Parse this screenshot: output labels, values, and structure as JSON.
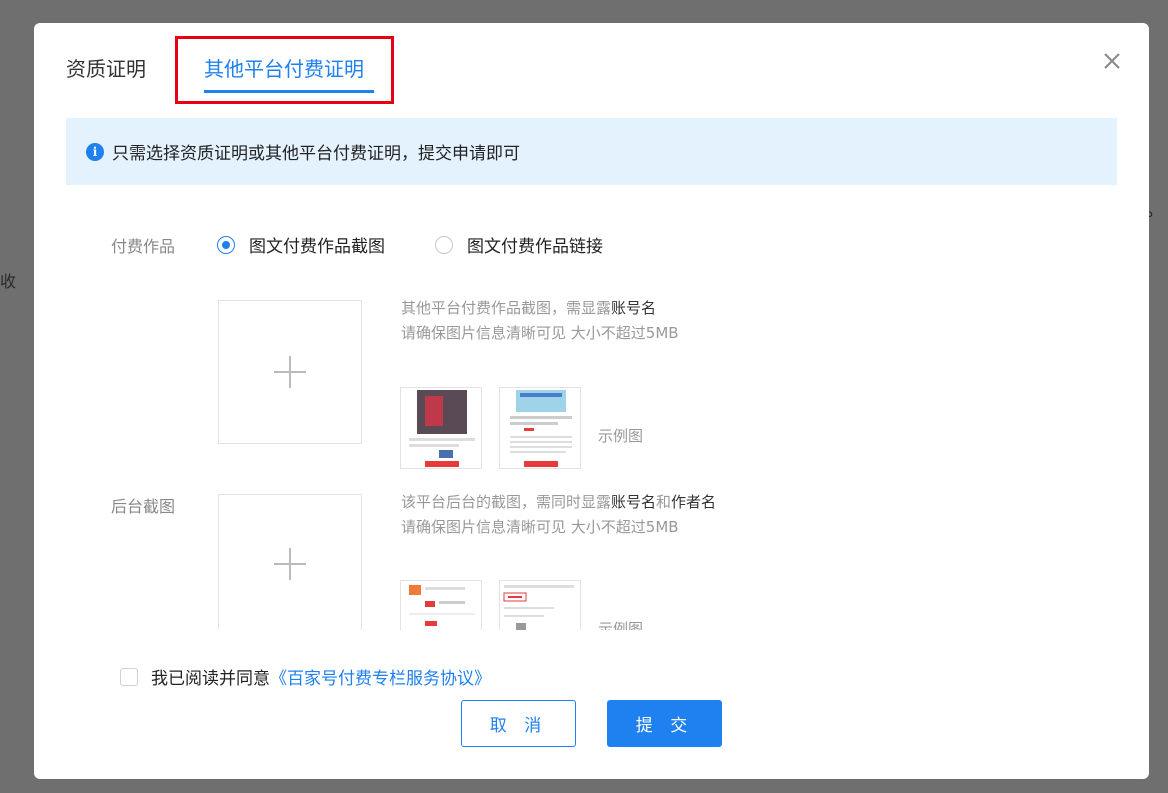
{
  "background": {
    "edge_right_text": "。",
    "edge_left_text": "收"
  },
  "modal": {
    "tabs": [
      {
        "label": "资质证明",
        "active": false
      },
      {
        "label": "其他平台付费证明",
        "active": true
      }
    ],
    "notice": {
      "icon": "info-icon",
      "icon_glyph": "i",
      "text": "只需选择资质证明或其他平台付费证明，提交申请即可"
    },
    "paid_work": {
      "label": "付费作品",
      "options": [
        {
          "label": "图文付费作品截图",
          "checked": true
        },
        {
          "label": "图文付费作品链接",
          "checked": false
        }
      ],
      "hint_prefix": "其他平台付费作品截图，需显露",
      "hint_strong": "账号名",
      "hint_size": "请确保图片信息清晰可见 大小不超过5MB",
      "sample_label": "示例图"
    },
    "backend": {
      "label": "后台截图",
      "hint_prefix": "该平台后台的截图，需同时显露",
      "hint_strong_1": "账号名",
      "hint_join": "和",
      "hint_strong_2": "作者名",
      "hint_size": "请确保图片信息清晰可见 大小不超过5MB",
      "sample_label": "示例图"
    },
    "agreement": {
      "text": "我已阅读并同意",
      "link": "《百家号付费专栏服务协议》",
      "checked": false
    },
    "buttons": {
      "cancel": "取 消",
      "submit": "提 交"
    },
    "colors": {
      "accent": "#1f80f0",
      "highlight": "#e60012",
      "notice_bg": "#e4f2fd"
    }
  }
}
